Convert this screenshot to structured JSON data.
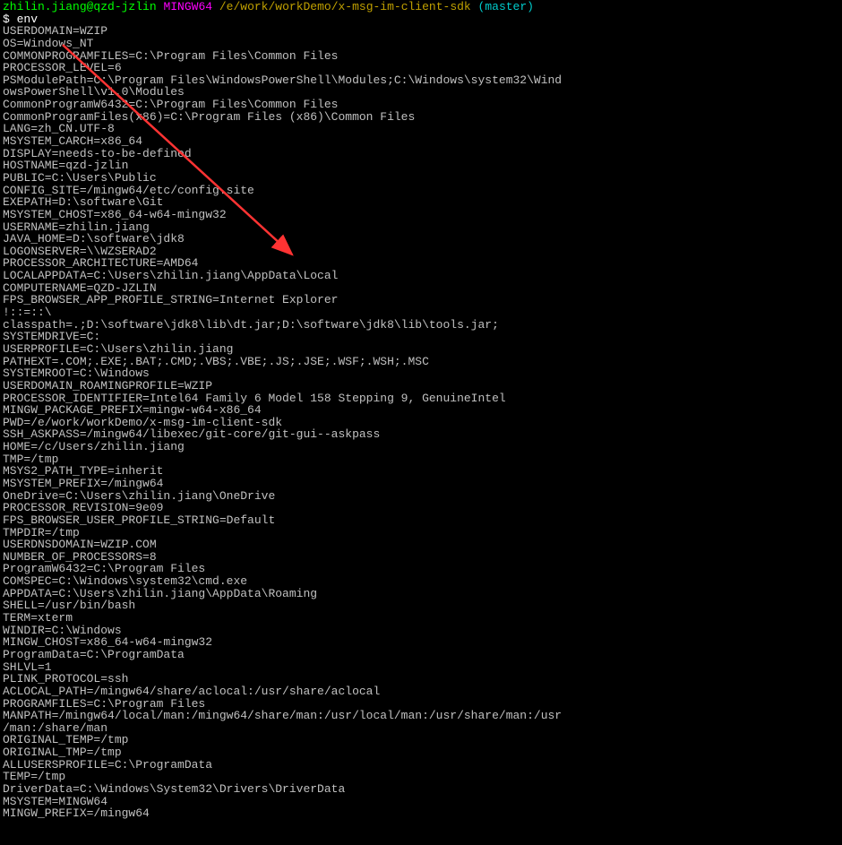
{
  "prompt": {
    "user": "zhilin.jiang@qzd-jzlin",
    "mingw": "MINGW64",
    "path": "/e/work/workDemo/x-msg-im-client-sdk",
    "branch": "(master)",
    "dollar": "$ ",
    "command": "env"
  },
  "lines": [
    "USERDOMAIN=WZIP",
    "OS=Windows_NT",
    "COMMONPROGRAMFILES=C:\\Program Files\\Common Files",
    "PROCESSOR_LEVEL=6",
    "PSModulePath=C:\\Program Files\\WindowsPowerShell\\Modules;C:\\Windows\\system32\\Wind",
    "owsPowerShell\\v1.0\\Modules",
    "CommonProgramW6432=C:\\Program Files\\Common Files",
    "CommonProgramFiles(x86)=C:\\Program Files (x86)\\Common Files",
    "LANG=zh_CN.UTF-8",
    "MSYSTEM_CARCH=x86_64",
    "DISPLAY=needs-to-be-defined",
    "HOSTNAME=qzd-jzlin",
    "PUBLIC=C:\\Users\\Public",
    "CONFIG_SITE=/mingw64/etc/config.site",
    "EXEPATH=D:\\software\\Git",
    "MSYSTEM_CHOST=x86_64-w64-mingw32",
    "USERNAME=zhilin.jiang",
    "JAVA_HOME=D:\\software\\jdk8",
    "LOGONSERVER=\\\\WZSERAD2",
    "PROCESSOR_ARCHITECTURE=AMD64",
    "LOCALAPPDATA=C:\\Users\\zhilin.jiang\\AppData\\Local",
    "COMPUTERNAME=QZD-JZLIN",
    "FPS_BROWSER_APP_PROFILE_STRING=Internet Explorer",
    "!::=::\\",
    "classpath=.;D:\\software\\jdk8\\lib\\dt.jar;D:\\software\\jdk8\\lib\\tools.jar;",
    "SYSTEMDRIVE=C:",
    "USERPROFILE=C:\\Users\\zhilin.jiang",
    "PATHEXT=.COM;.EXE;.BAT;.CMD;.VBS;.VBE;.JS;.JSE;.WSF;.WSH;.MSC",
    "SYSTEMROOT=C:\\Windows",
    "USERDOMAIN_ROAMINGPROFILE=WZIP",
    "PROCESSOR_IDENTIFIER=Intel64 Family 6 Model 158 Stepping 9, GenuineIntel",
    "MINGW_PACKAGE_PREFIX=mingw-w64-x86_64",
    "PWD=/e/work/workDemo/x-msg-im-client-sdk",
    "SSH_ASKPASS=/mingw64/libexec/git-core/git-gui--askpass",
    "HOME=/c/Users/zhilin.jiang",
    "TMP=/tmp",
    "MSYS2_PATH_TYPE=inherit",
    "MSYSTEM_PREFIX=/mingw64",
    "OneDrive=C:\\Users\\zhilin.jiang\\OneDrive",
    "PROCESSOR_REVISION=9e09",
    "FPS_BROWSER_USER_PROFILE_STRING=Default",
    "TMPDIR=/tmp",
    "USERDNSDOMAIN=WZIP.COM",
    "NUMBER_OF_PROCESSORS=8",
    "ProgramW6432=C:\\Program Files",
    "COMSPEC=C:\\Windows\\system32\\cmd.exe",
    "APPDATA=C:\\Users\\zhilin.jiang\\AppData\\Roaming",
    "SHELL=/usr/bin/bash",
    "TERM=xterm",
    "WINDIR=C:\\Windows",
    "MINGW_CHOST=x86_64-w64-mingw32",
    "ProgramData=C:\\ProgramData",
    "SHLVL=1",
    "PLINK_PROTOCOL=ssh",
    "ACLOCAL_PATH=/mingw64/share/aclocal:/usr/share/aclocal",
    "PROGRAMFILES=C:\\Program Files",
    "MANPATH=/mingw64/local/man:/mingw64/share/man:/usr/local/man:/usr/share/man:/usr",
    "/man:/share/man",
    "ORIGINAL_TEMP=/tmp",
    "ORIGINAL_TMP=/tmp",
    "ALLUSERSPROFILE=C:\\ProgramData",
    "TEMP=/tmp",
    "DriverData=C:\\Windows\\System32\\Drivers\\DriverData",
    "MSYSTEM=MINGW64",
    "MINGW_PREFIX=/mingw64"
  ]
}
